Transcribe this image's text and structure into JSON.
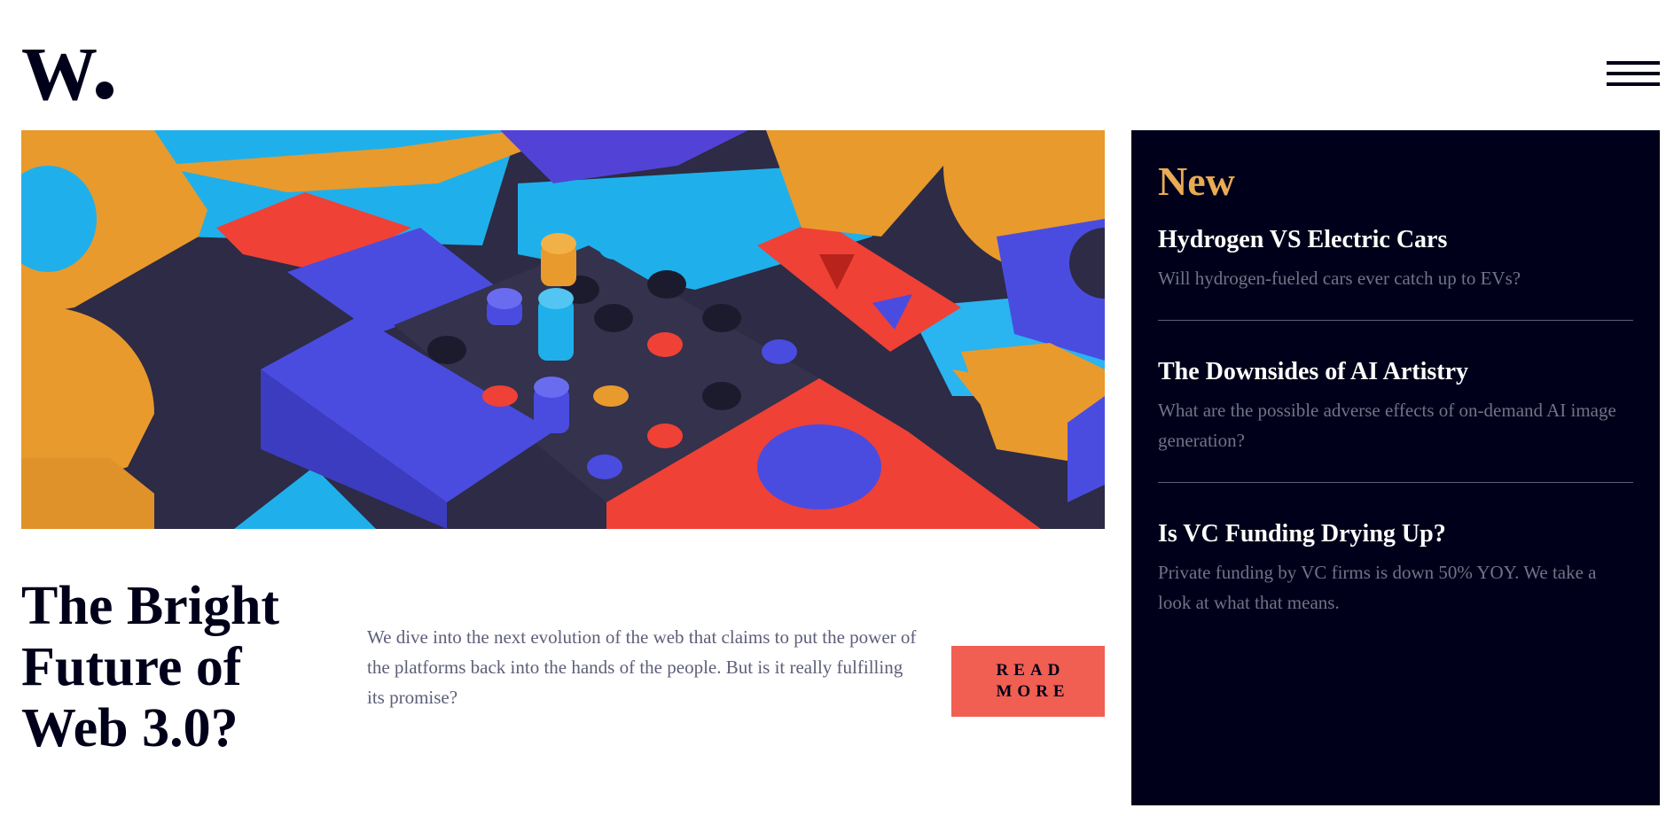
{
  "brand": {
    "logo_text": "W"
  },
  "header": {
    "menu_icon": "hamburger-menu-icon"
  },
  "hero": {
    "image": "colorful-3d-blocks-illustration",
    "colors": {
      "orange": "#e99a2c",
      "blue": "#4a4ce0",
      "cyan": "#1fb0eb",
      "red": "#ef4136",
      "dark": "#2d2b45"
    }
  },
  "main": {
    "title": "The Bright Future of Web 3.0?",
    "teaser": "We dive into the next evolution of the web that claims to put the power of the platforms back into the hands of the people. But is it really fulfilling its promise?",
    "cta_label": "READ MORE"
  },
  "sidebar": {
    "heading": "New",
    "items": [
      {
        "title": "Hydrogen VS Electric Cars",
        "summary": "Will hydrogen-fueled cars ever catch up to EVs?"
      },
      {
        "title": "The Downsides of AI Artistry",
        "summary": "What are the possible adverse effects of on-demand AI image generation?"
      },
      {
        "title": "Is VC Funding Drying Up?",
        "summary": "Private funding by VC firms is down 50% YOY. We take a look at what that means."
      }
    ]
  },
  "colors": {
    "navy": "#00001a",
    "accent_orange": "#e9ab53",
    "soft_red": "#f05f52",
    "grayish_blue": "#5d5f79",
    "white": "#ffffff"
  }
}
